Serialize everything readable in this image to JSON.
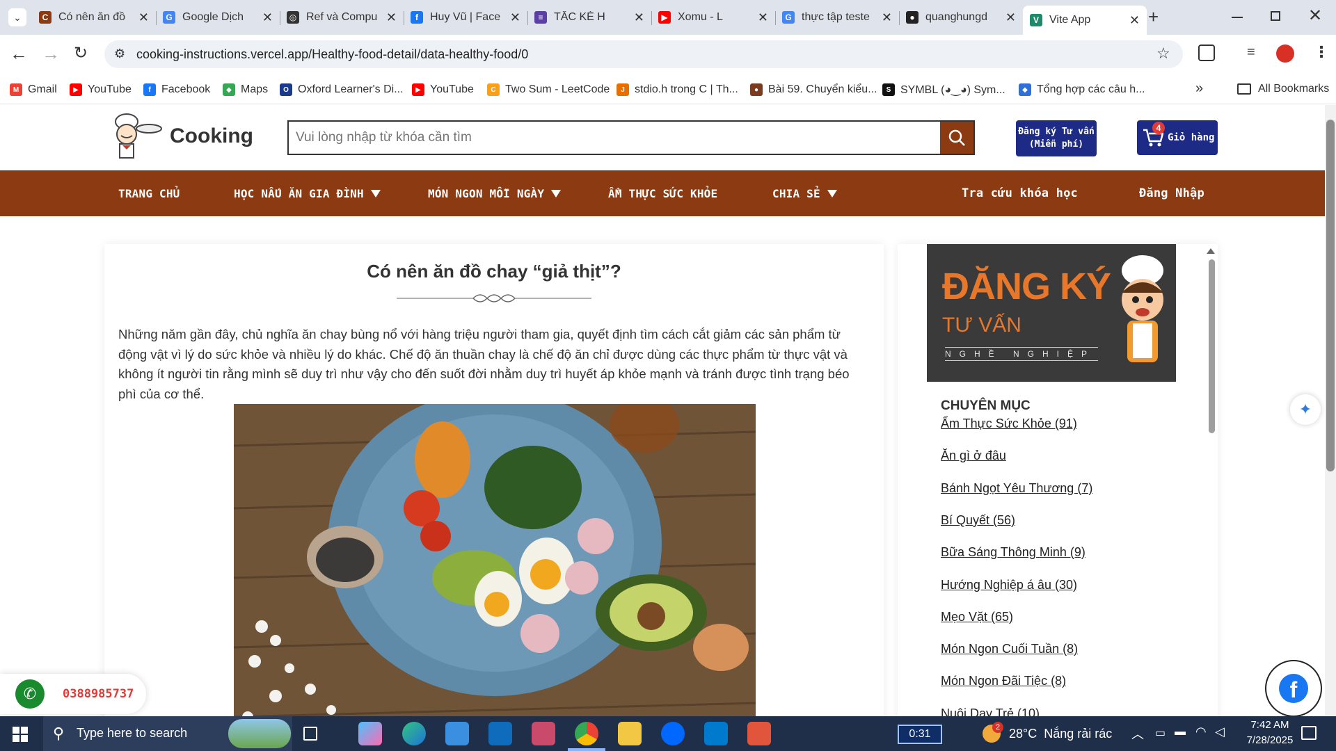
{
  "browser": {
    "tabs": [
      {
        "title": "Có nên ăn đồ",
        "icon": "site-favicon",
        "color": "#8b3a12",
        "glyph": "C"
      },
      {
        "title": "Google Dịch",
        "icon": "translate-icon",
        "color": "#4285f4",
        "glyph": "G"
      },
      {
        "title": "Ref và Compu",
        "icon": "openai-icon",
        "color": "#333333",
        "glyph": "◎"
      },
      {
        "title": "Huy Vũ | Face",
        "icon": "facebook-icon",
        "color": "#1877f2",
        "glyph": "f"
      },
      {
        "title": "TẮC KÈ H",
        "icon": "notes-icon",
        "color": "#5b3fa6",
        "glyph": "≡"
      },
      {
        "title": "Xomu - L",
        "icon": "youtube-icon",
        "color": "#ff0000",
        "glyph": "▶"
      },
      {
        "title": "thực tập teste",
        "icon": "google-icon",
        "color": "#4285f4",
        "glyph": "G"
      },
      {
        "title": "quanghungd",
        "icon": "github-icon",
        "color": "#222222",
        "glyph": "●"
      },
      {
        "title": "Vite App",
        "icon": "vercel-icon",
        "color": "#1e8a6c",
        "glyph": "V"
      }
    ],
    "address": "cooking-instructions.vercel.app/Healthy-food-detail/data-healthy-food/0",
    "bookmarks": [
      {
        "label": "Gmail",
        "color": "#ea4335",
        "glyph": "M"
      },
      {
        "label": "YouTube",
        "color": "#ff0000",
        "glyph": "▶"
      },
      {
        "label": "Facebook",
        "color": "#1877f2",
        "glyph": "f"
      },
      {
        "label": "Maps",
        "color": "#34a853",
        "glyph": "◆"
      },
      {
        "label": "Oxford Learner's Di...",
        "color": "#1a3a8a",
        "glyph": "O"
      },
      {
        "label": "YouTube",
        "color": "#ff0000",
        "glyph": "▶"
      },
      {
        "label": "Two Sum - LeetCode",
        "color": "#f89f1b",
        "glyph": "C"
      },
      {
        "label": "stdio.h trong C | Th...",
        "color": "#e76f00",
        "glyph": "J"
      },
      {
        "label": "Bài 59. Chuyển kiểu...",
        "color": "#7a3b1e",
        "glyph": "●"
      },
      {
        "label": "SYMBL (◕‿◕) Sym...",
        "color": "#111111",
        "glyph": "S"
      },
      {
        "label": "Tổng hợp các câu h...",
        "color": "#2f6fd6",
        "glyph": "◆"
      }
    ],
    "all_bookmarks": "All Bookmarks"
  },
  "site": {
    "logo_text": "Cooking",
    "search_placeholder": "Vui lòng nhập từ khóa cần tìm",
    "register_btn": [
      "Đăng ký Tư vấn",
      "(Miễn phí)"
    ],
    "cart_label": "Giỏ hàng",
    "cart_count": "4",
    "nav": [
      {
        "label": "TRANG CHỦ",
        "dropdown": false
      },
      {
        "label": "HỌC NẤU ĂN GIA ĐÌNH",
        "dropdown": true
      },
      {
        "label": "MÓN NGON MỖI NGÀY",
        "dropdown": true
      },
      {
        "label": "ẨM THỰC SỨC KHỎE",
        "dropdown": false
      },
      {
        "label": "CHIA SẺ",
        "dropdown": true
      },
      {
        "label": "Tra cứu khóa học",
        "dropdown": false
      },
      {
        "label": "Đăng Nhập",
        "dropdown": false
      }
    ]
  },
  "article": {
    "title": "Có nên ăn đồ chay “giả thịt”?",
    "intro": "Những năm gần đây, chủ nghĩa ăn chay bùng nổ với hàng triệu người tham gia, quyết định tìm cách cắt giảm các sản phẩm từ động vật vì lý do sức khỏe và nhiều lý do khác. Chế độ ăn thuần chay là chế độ ăn chỉ được dùng các thực phẩm từ thực vật và không ít người tin rằng mình sẽ duy trì như vậy cho đến suốt đời nhằm duy trì huyết áp khỏe mạnh và tránh được tình trạng béo phì của cơ thể."
  },
  "sidebar": {
    "banner": {
      "line1": "ĐĂNG KÝ",
      "line2": "TƯ VẤN",
      "line3": "NGHỀ NGHIỆP"
    },
    "heading": "CHUYÊN MỤC",
    "categories": [
      "Ẩm Thực Sức Khỏe (91)",
      "Ăn gì ở đâu",
      "Bánh Ngọt Yêu Thương (7)",
      "Bí Quyết (56)",
      "Bữa Sáng Thông Minh (9)",
      "Hướng Nghiệp á âu (30)",
      "Mẹo Vặt (65)",
      "Món Ngon Cuối Tuần (8)",
      "Món Ngon Đãi Tiệc (8)",
      "Nuôi Dạy Trẻ (10)"
    ]
  },
  "floating": {
    "phone": "0388985737"
  },
  "taskbar": {
    "search_placeholder": "Type here to search",
    "timer": "0:31",
    "weather": "28°C  Nắng rải rác",
    "weather_badge": "2",
    "time": "7:42 AM",
    "date": "7/28/2025"
  }
}
